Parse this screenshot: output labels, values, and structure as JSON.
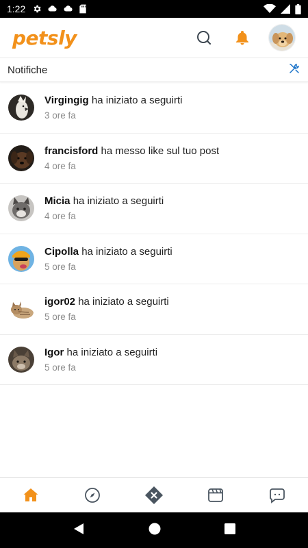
{
  "status_bar": {
    "time": "1:22"
  },
  "app": {
    "logo": "petsly",
    "brand_color": "#f2911b",
    "accent_color": "#1a73c9"
  },
  "notifications_header": {
    "title": "Notifiche"
  },
  "notifications": [
    {
      "user": "Virgingig",
      "action": "ha iniziato a seguirti",
      "time": "3 ore fa",
      "avatar": "cockatoo"
    },
    {
      "user": "francisford",
      "action": "ha messo like sul tuo post",
      "time": "4 ore fa",
      "avatar": "dog-dark"
    },
    {
      "user": "Micia",
      "action": "ha iniziato a seguirti",
      "time": "4 ore fa",
      "avatar": "cat-grey"
    },
    {
      "user": "Cipolla",
      "action": "ha iniziato a seguirti",
      "time": "5 ore fa",
      "avatar": "dog-sunglasses"
    },
    {
      "user": "igor02",
      "action": "ha iniziato a seguirti",
      "time": "5 ore fa",
      "avatar": "cat-tabby"
    },
    {
      "user": "Igor",
      "action": "ha iniziato a seguirti",
      "time": "5 ore fa",
      "avatar": "cat-tabby-dark"
    }
  ],
  "bottom_nav": [
    "home-icon",
    "compass-icon",
    "close-diamond-icon",
    "clapperboard-icon",
    "chat-icon"
  ]
}
